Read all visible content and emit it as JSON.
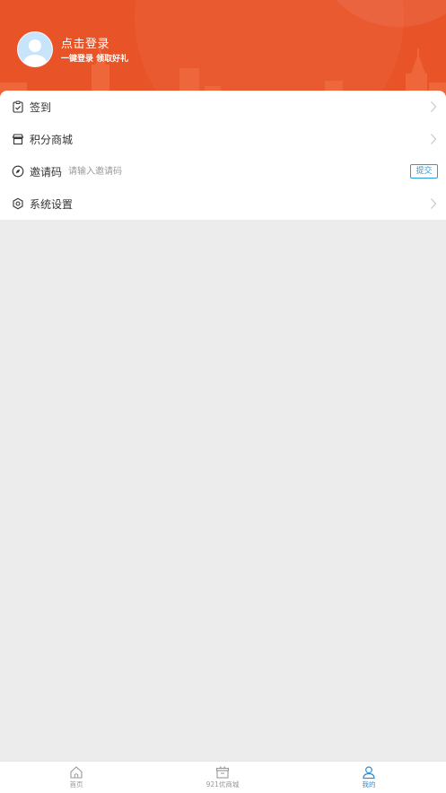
{
  "header": {
    "login_title": "点击登录",
    "login_subtitle": "一键登录  领取好礼",
    "bg_color": "#e85328"
  },
  "menu": {
    "items": [
      {
        "key": "sign_in",
        "label": "签到",
        "icon": "clipboard-check-icon"
      },
      {
        "key": "points_mall",
        "label": "积分商城",
        "icon": "shop-icon"
      },
      {
        "key": "invite_code",
        "label": "邀请码",
        "icon": "compass-icon",
        "placeholder": "请输入邀请码",
        "value": "",
        "submit_label": "提交"
      },
      {
        "key": "settings",
        "label": "系统设置",
        "icon": "hexagon-gear-icon"
      }
    ]
  },
  "tabbar": {
    "items": [
      {
        "label": "首页",
        "icon": "home-icon",
        "active": false
      },
      {
        "label": "921优商城",
        "icon": "gift-box-icon",
        "active": false
      },
      {
        "label": "我的",
        "icon": "user-icon",
        "active": true
      }
    ],
    "active_color": "#2d8fd6",
    "inactive_color": "#999999"
  }
}
